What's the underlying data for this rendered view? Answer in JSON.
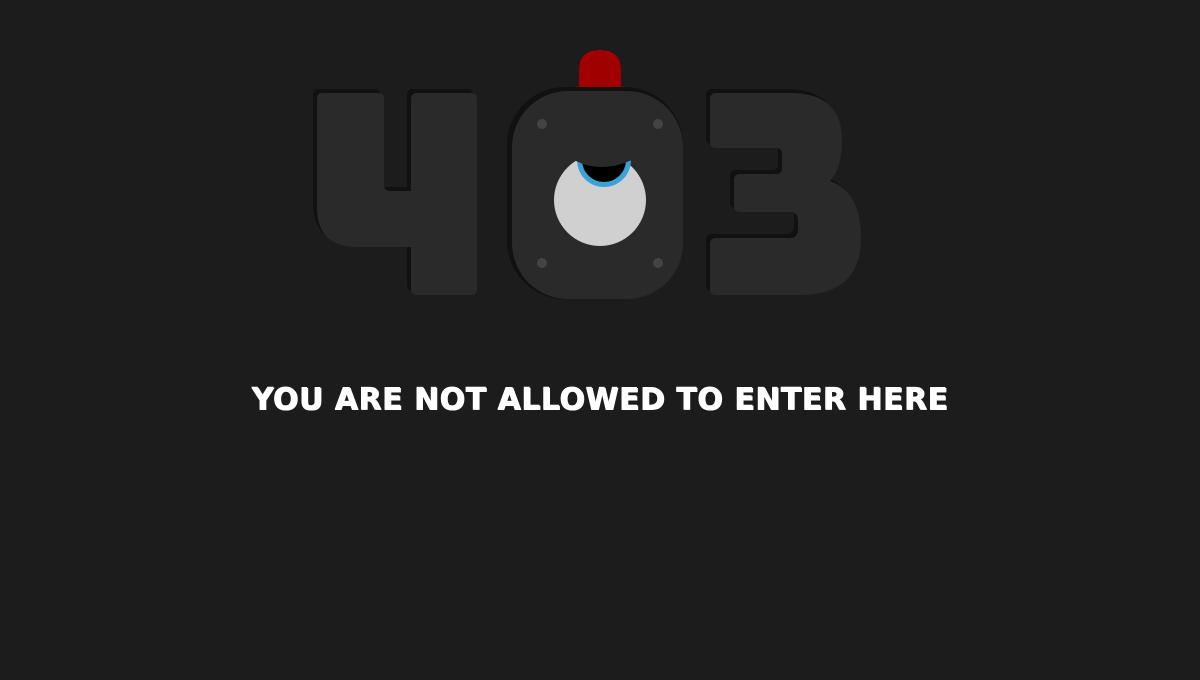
{
  "error": {
    "code": "403",
    "message": "YOU ARE NOT ALLOWED TO ENTER HERE"
  },
  "colors": {
    "background": "#1c1c1c",
    "digits": "#2a2a2a",
    "alarm_light": "#a10000",
    "eye_white": "#d0d0d0",
    "eye_ring": "#3aa3d6",
    "message_text": "#ffffff"
  },
  "icons": {
    "robot": "robot-watchman-icon",
    "alarm": "alarm-light-icon",
    "eye": "eye-icon"
  }
}
